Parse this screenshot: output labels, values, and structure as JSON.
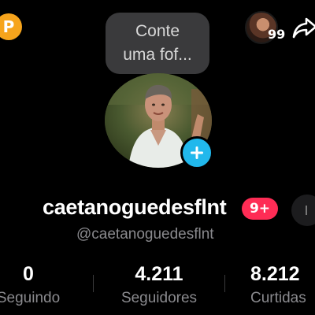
{
  "header": {
    "coin_letter": "P",
    "note_bubble": {
      "line1": "Conte",
      "line2": "uma fof..."
    },
    "friends_count": "99"
  },
  "profile": {
    "username": "caetanoguedesflnt",
    "notification_badge": "9+",
    "handle": "@caetanoguedesflnt"
  },
  "stats": [
    {
      "value": "0",
      "label": "Seguindo"
    },
    {
      "value": "4.211",
      "label": "Seguidores"
    },
    {
      "value": "8.212",
      "label": "Curtidas"
    }
  ],
  "colors": {
    "background": "#000000",
    "accent_blue": "#21b8ec",
    "badge_red": "#fe2c55",
    "coin_orange": "#f6a41c",
    "secondary_text": "#8a8a8e"
  },
  "icons": {
    "coin": "coin-icon",
    "share": "share-arrow-icon",
    "add": "plus-icon"
  }
}
